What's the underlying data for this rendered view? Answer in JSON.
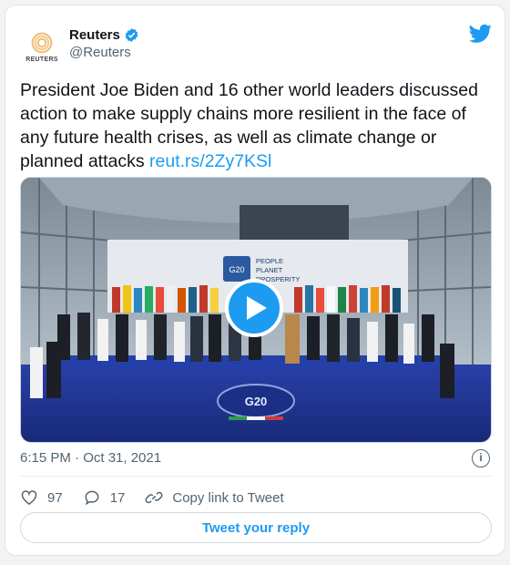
{
  "account": {
    "name": "Reuters",
    "handle": "@Reuters",
    "avatar_label": "REUTERS",
    "verified_icon": "verified-badge-icon"
  },
  "tweet": {
    "text": "President Joe Biden and 16 other world leaders discussed action to make supply chains more resilient in the face of any future health crises, as well as climate change or planned attacks ",
    "link": "reut.rs/2Zy7KSl"
  },
  "media": {
    "banner_line1": "PEOPLE",
    "banner_line2": "PLANET",
    "banner_line3": "PROSPERITY",
    "logo_text": "G20",
    "floor_logo": "G20",
    "play_icon": "play-icon"
  },
  "meta": {
    "timestamp": "6:15 PM · Oct 31, 2021",
    "info_icon": "info-icon"
  },
  "actions": {
    "likes": "97",
    "replies": "17",
    "copy_link": "Copy link to Tweet"
  },
  "reply_button": "Tweet your reply",
  "colors": {
    "accent": "#1d9bf0",
    "text": "#0f1419",
    "muted": "#536471"
  }
}
